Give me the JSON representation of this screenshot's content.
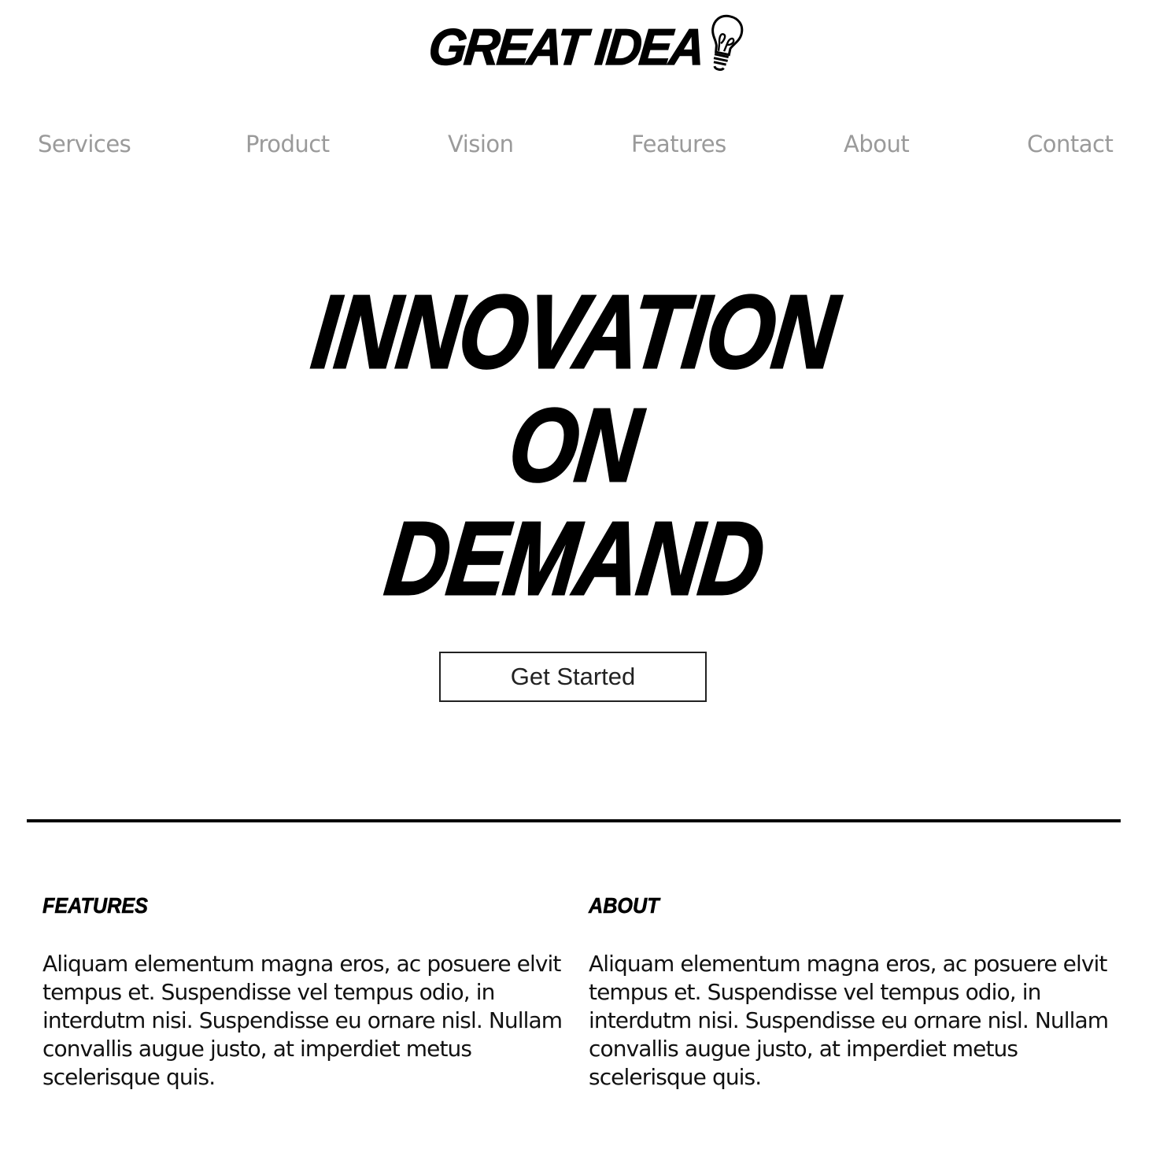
{
  "logo": {
    "text": "GREAT IDEA"
  },
  "nav": {
    "items": [
      {
        "label": "Services"
      },
      {
        "label": "Product"
      },
      {
        "label": "Vision"
      },
      {
        "label": "Features"
      },
      {
        "label": "About"
      },
      {
        "label": "Contact"
      }
    ]
  },
  "hero": {
    "lines": [
      "INNOVATION",
      "ON",
      "DEMAND"
    ],
    "cta_label": "Get Started"
  },
  "sections": [
    {
      "heading": "FEATURES",
      "body": "Aliquam elementum magna eros, ac posuere elvit tempus et. Suspendisse vel tempus odio, in interdutm nisi. Suspendisse eu ornare nisl. Nullam convallis augue justo, at imperdiet metus scelerisque quis."
    },
    {
      "heading": "ABOUT",
      "body": "Aliquam elementum magna eros, ac posuere elvit tempus et. Suspendisse vel tempus odio, in interdutm nisi. Suspendisse eu ornare nisl. Nullam convallis augue justo, at imperdiet metus scelerisque quis."
    }
  ],
  "colors": {
    "nav_text": "#9a9a9a",
    "text": "#000000",
    "background": "#ffffff"
  }
}
